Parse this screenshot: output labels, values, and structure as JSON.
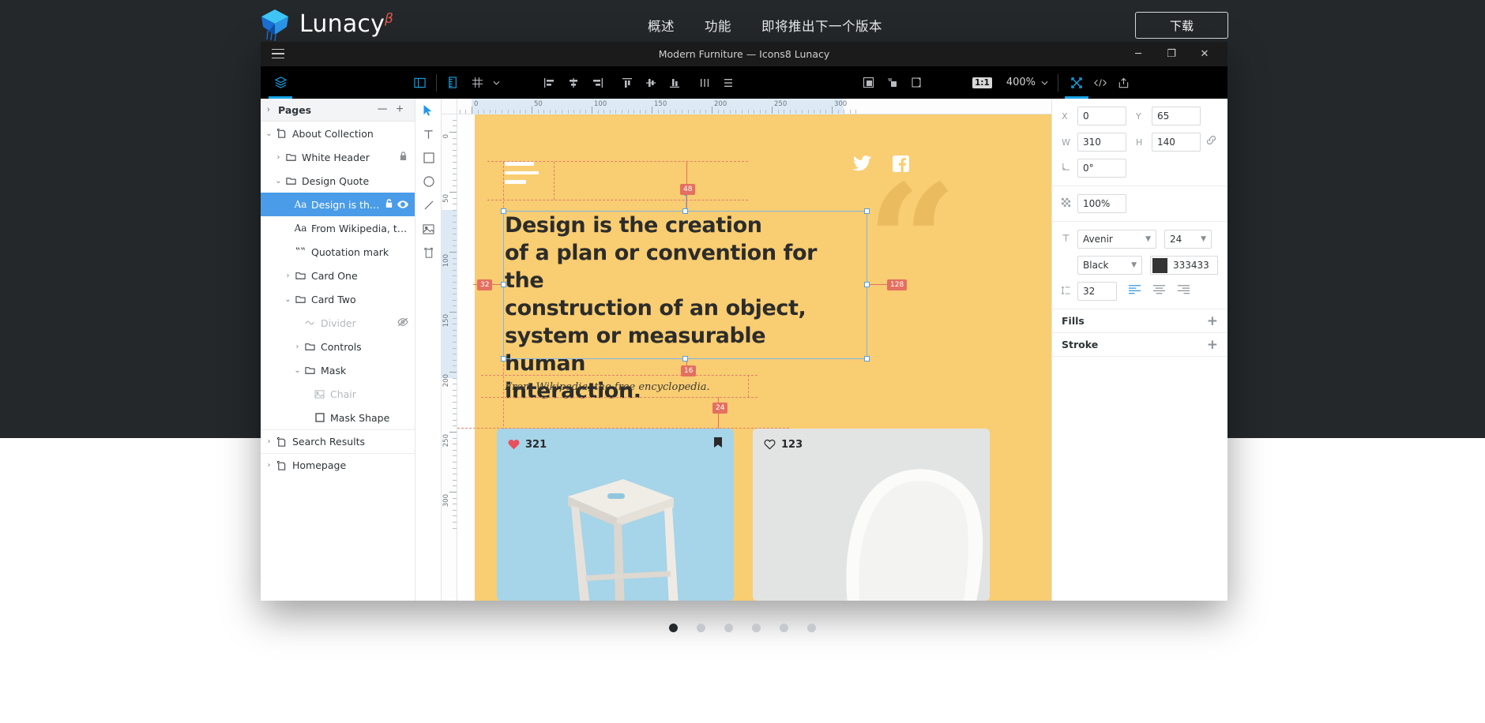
{
  "site": {
    "brand": {
      "name": "Lunacy",
      "beta": "β"
    },
    "nav": [
      {
        "label": "概述"
      },
      {
        "label": "功能"
      },
      {
        "label": "即将推出下一个版本"
      }
    ],
    "download_label": "下载"
  },
  "app": {
    "title": "Modern Furniture — Icons8 Lunacy",
    "window_controls": {
      "minimize": "─",
      "maximize": "❐",
      "close": "✕"
    },
    "toolbar": {
      "zoom_value": "400%",
      "ratio_badge": "1:1",
      "icons": [
        "layers-icon",
        "panel-toggle-icon",
        "ruler-icon",
        "grid-icon",
        "align-left-icon",
        "align-center-h-icon",
        "align-right-icon",
        "align-top-icon",
        "align-middle-v-icon",
        "align-bottom-icon",
        "distribute-h-icon",
        "distribute-v-icon",
        "mask-icon",
        "flatten-icon",
        "boolean-icon",
        "fullscreen-icon",
        "code-icon",
        "export-icon"
      ]
    },
    "tools": [
      {
        "name": "cursor-tool",
        "active": true
      },
      {
        "name": "text-tool",
        "active": false
      },
      {
        "name": "rectangle-tool",
        "active": false
      },
      {
        "name": "ellipse-tool",
        "active": false
      },
      {
        "name": "line-tool",
        "active": false
      },
      {
        "name": "image-tool",
        "active": false
      },
      {
        "name": "artboard-tool",
        "active": false
      }
    ]
  },
  "pages_panel": {
    "title": "Pages",
    "collapse_label": "─",
    "add_label": "+",
    "rows": [
      {
        "label": "About Collection",
        "caret": "⌄",
        "icon": "page-icon",
        "indent": 0,
        "selected": false,
        "dim": false,
        "right": "",
        "sep": false
      },
      {
        "label": "White Header",
        "caret": "›",
        "icon": "folder-icon",
        "indent": 1,
        "selected": false,
        "dim": false,
        "right": "lock-icon",
        "sep": false
      },
      {
        "label": "Design Quote",
        "caret": "⌄",
        "icon": "folder-icon",
        "indent": 1,
        "selected": false,
        "dim": false,
        "right": "",
        "sep": false
      },
      {
        "label": "Design is the crea…",
        "caret": "",
        "icon": "text-layer-icon",
        "indent": 2,
        "selected": true,
        "dim": false,
        "right": "unlock-eye",
        "sep": false
      },
      {
        "label": "From Wikipedia, the free…",
        "caret": "",
        "icon": "text-layer-icon",
        "indent": 2,
        "selected": false,
        "dim": false,
        "right": "",
        "sep": false
      },
      {
        "label": "Quotation mark",
        "caret": "",
        "icon": "quote-icon",
        "indent": 2,
        "selected": false,
        "dim": false,
        "right": "",
        "sep": false
      },
      {
        "label": "Card One",
        "caret": "›",
        "icon": "folder-icon",
        "indent": 2,
        "selected": false,
        "dim": false,
        "right": "",
        "sep": false
      },
      {
        "label": "Card Two",
        "caret": "⌄",
        "icon": "folder-icon",
        "indent": 2,
        "selected": false,
        "dim": false,
        "right": "",
        "sep": false
      },
      {
        "label": "Divider",
        "caret": "",
        "icon": "wave-icon",
        "indent": 3,
        "selected": false,
        "dim": true,
        "right": "hidden-eye-icon",
        "sep": false
      },
      {
        "label": "Controls",
        "caret": "›",
        "icon": "folder-icon",
        "indent": 3,
        "selected": false,
        "dim": false,
        "right": "",
        "sep": false
      },
      {
        "label": "Mask",
        "caret": "⌄",
        "icon": "folder-icon",
        "indent": 3,
        "selected": false,
        "dim": false,
        "right": "",
        "sep": false
      },
      {
        "label": "Chair",
        "caret": "",
        "icon": "image-layer-icon",
        "indent": 4,
        "selected": false,
        "dim": true,
        "right": "",
        "sep": false
      },
      {
        "label": "Mask Shape",
        "caret": "",
        "icon": "rect-layer-icon",
        "indent": 4,
        "selected": false,
        "dim": false,
        "right": "",
        "sep": false
      },
      {
        "label": "Search Results",
        "caret": "›",
        "icon": "page-icon",
        "indent": 0,
        "selected": false,
        "dim": false,
        "right": "",
        "sep": true
      },
      {
        "label": "Homepage",
        "caret": "›",
        "icon": "page-icon",
        "indent": 0,
        "selected": false,
        "dim": false,
        "right": "",
        "sep": true
      }
    ]
  },
  "properties": {
    "x_label": "X",
    "x_value": "0",
    "y_label": "Y",
    "y_value": "65",
    "w_label": "W",
    "w_value": "310",
    "h_label": "H",
    "h_value": "140",
    "rotation_value": "0°",
    "opacity_value": "100%",
    "font_family": "Avenir",
    "font_size": "24",
    "font_weight": "Black",
    "color_hex": "333433",
    "color_swatch": "#333433",
    "line_height": "32",
    "fills_label": "Fills",
    "stroke_label": "Stroke",
    "add_symbol": "+"
  },
  "canvas": {
    "ruler_h_labels": [
      "0",
      "50",
      "100",
      "150",
      "200",
      "250",
      "300"
    ],
    "ruler_v_labels": [
      "0",
      "50",
      "100",
      "150",
      "200",
      "250",
      "300"
    ],
    "artboard": {
      "background": "#f9cd72",
      "quote_mark": "“",
      "quote_lines": [
        "Design is the creation",
        "of a plan or convention for the",
        "construction of an object,",
        "system or measurable human",
        "interaction."
      ],
      "attribution": "From Wikipedia, the free encyclopedia."
    },
    "spacing_badges": [
      {
        "value": "48"
      },
      {
        "value": "32"
      },
      {
        "value": "128"
      },
      {
        "value": "16"
      },
      {
        "value": "24"
      }
    ],
    "cards": [
      {
        "likes": "321",
        "liked": true,
        "bookmarked": true,
        "bg": "#a6d4e8"
      },
      {
        "likes": "123",
        "liked": false,
        "bookmarked": false,
        "bg": "#e2e3e3"
      }
    ]
  },
  "carousel": {
    "dots": [
      {
        "active": true
      },
      {
        "active": false
      },
      {
        "active": false
      },
      {
        "active": false
      },
      {
        "active": false
      },
      {
        "active": false
      }
    ]
  }
}
